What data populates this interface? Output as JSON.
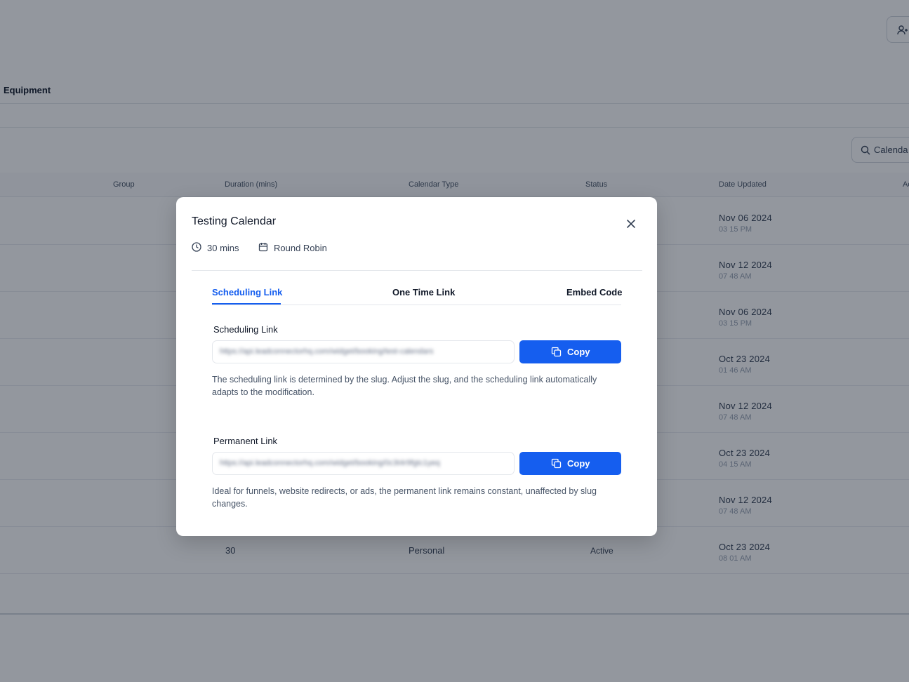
{
  "background": {
    "section_title": "Equipment",
    "search_placeholder": "Calenda",
    "columns": [
      "Group",
      "Duration (mins)",
      "Calendar Type",
      "Status",
      "Date Updated",
      "Ac"
    ],
    "rows": [
      {
        "date": "Nov 06 2024",
        "time": "03 15 PM"
      },
      {
        "date": "Nov 12 2024",
        "time": "07 48 AM"
      },
      {
        "date": "Nov 06 2024",
        "time": "03 15 PM"
      },
      {
        "date": "Oct 23 2024",
        "time": "01 46 AM"
      },
      {
        "date": "Nov 12 2024",
        "time": "07 48 AM"
      },
      {
        "date": "Oct 23 2024",
        "time": "04 15 AM"
      },
      {
        "date": "Nov 12 2024",
        "time": "07 48 AM"
      },
      {
        "duration": "30",
        "type": "Personal",
        "status": "Active",
        "date": "Oct 23 2024",
        "time": "08 01 AM"
      }
    ]
  },
  "modal": {
    "title": "Testing Calendar",
    "duration": "30 mins",
    "calendar_type": "Round Robin",
    "tabs": [
      "Scheduling Link",
      "One Time Link",
      "Embed Code"
    ],
    "scheduling": {
      "label": "Scheduling Link",
      "url": "https://api.leadconnectorhq.com/widget/booking/test-calendars",
      "copy_label": "Copy",
      "help": "The scheduling link is determined by the slug. Adjust the slug, and the scheduling link automatically adapts to the modification."
    },
    "permanent": {
      "label": "Permanent Link",
      "url": "https://api.leadconnectorhq.com/widget/booking/0c3t4r9fgtc1yeq",
      "copy_label": "Copy",
      "help": "Ideal for funnels, website redirects, or ads, the permanent link remains constant, unaffected by slug changes."
    }
  },
  "colors": {
    "accent": "#155eef",
    "overlay": "rgba(16,24,40,0.45)"
  }
}
